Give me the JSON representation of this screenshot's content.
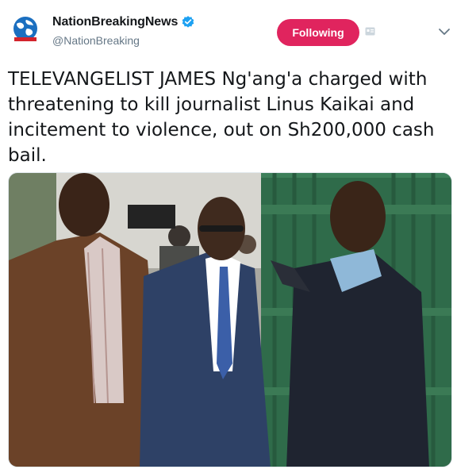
{
  "account": {
    "display_name": "NationBreakingNews",
    "handle": "@NationBreaking",
    "verified": true
  },
  "follow_button": {
    "label": "Following",
    "color": "#e0245e"
  },
  "tweet": {
    "text": "TELEVANGELIST JAMES Ng'ang'a charged with threatening to kill journalist Linus Kaikai and incitement to violence, out on Sh200,000 cash bail."
  },
  "icons": {
    "avatar": "globe-logo",
    "verified": "verified-badge-icon",
    "card_app": "card-app-icon",
    "menu": "chevron-down-icon"
  },
  "colors": {
    "verified_blue": "#1da1f2",
    "handle_gray": "#657786",
    "gate_green": "#2f6b4a"
  }
}
